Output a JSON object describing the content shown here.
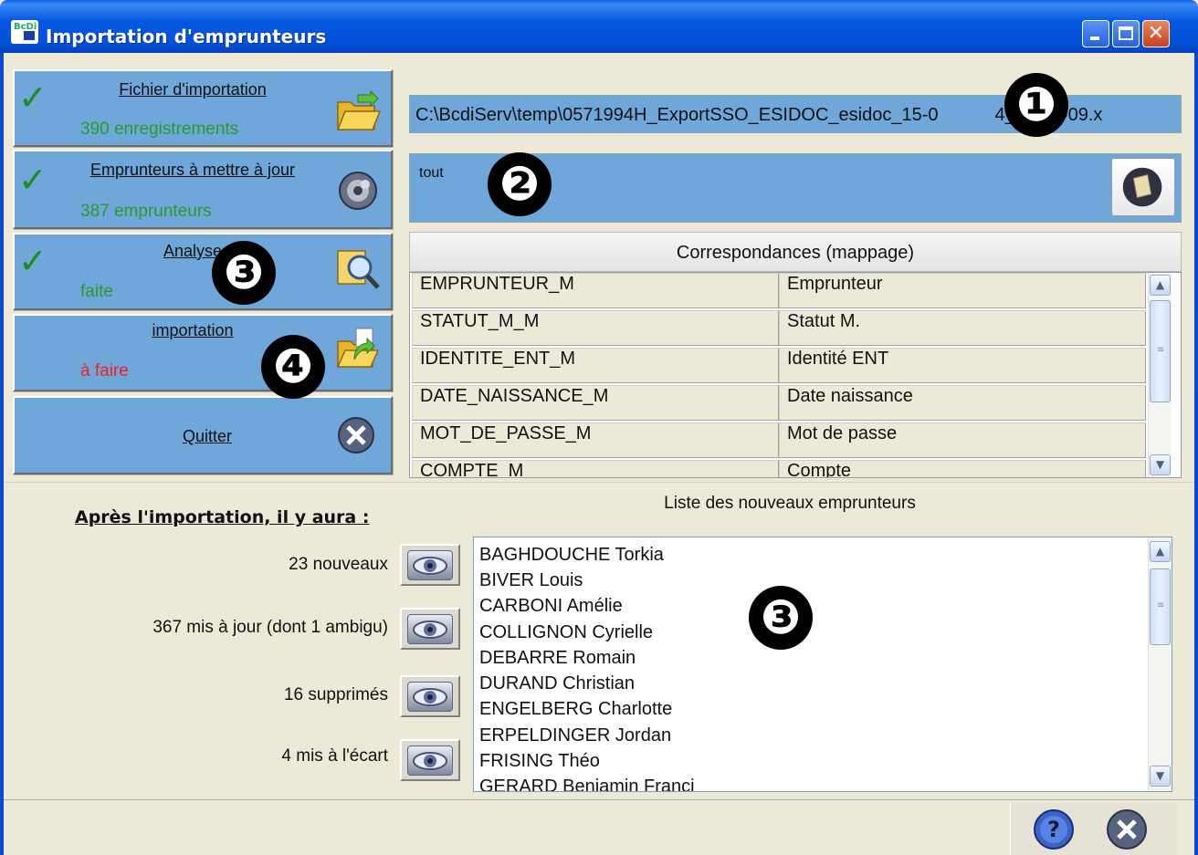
{
  "window": {
    "title": "Importation d'emprunteurs",
    "controls": {
      "minimize": "minimize",
      "maximize": "maximize",
      "close": "close"
    }
  },
  "steps": [
    {
      "title": "Fichier d'importation",
      "status": "390 enregistrements",
      "status_color": "#2a9a2a",
      "done": true,
      "icon": "folder-open-icon"
    },
    {
      "title": "Emprunteurs à mettre à jour",
      "status": "387 emprunteurs",
      "status_color": "#2a9a2a",
      "done": true,
      "icon": "gear-icon"
    },
    {
      "title": "Analyse",
      "status": "faite",
      "status_color": "#2a9a2a",
      "done": true,
      "icon": "magnifier-icon"
    },
    {
      "title": "importation",
      "status": "à faire",
      "status_color": "#ee2222",
      "done": false,
      "icon": "import-folder-icon"
    },
    {
      "title": "Quitter",
      "icon": "close-circle-icon"
    }
  ],
  "file_path": "C:\\BcdiServ\\temp\\0571994H_ExportSSO_ESIDOC_esidoc_15-0",
  "file_path_tail": "4_18-31-09.x",
  "filter": {
    "value": "tout",
    "button_icon": "filter-button-icon"
  },
  "mapping": {
    "header": "Correspondances  (mappage)",
    "rows": [
      {
        "field": "EMPRUNTEUR_M",
        "label": "Emprunteur"
      },
      {
        "field": "STATUT_M_M",
        "label": "Statut M."
      },
      {
        "field": "IDENTITE_ENT_M",
        "label": "Identité ENT"
      },
      {
        "field": "DATE_NAISSANCE_M",
        "label": "Date naissance"
      },
      {
        "field": "MOT_DE_PASSE_M",
        "label": "Mot de passe"
      },
      {
        "field": "COMPTE_M",
        "label": "Compte"
      }
    ]
  },
  "summary": {
    "title": "Après l'importation, il y aura :",
    "stats": [
      {
        "label": "23 nouveaux"
      },
      {
        "label": "367 mis à jour (dont 1 ambigu)"
      },
      {
        "label": "16 supprimés"
      },
      {
        "label": "4 mis à l'écart"
      }
    ]
  },
  "new_borrowers": {
    "title": "Liste des nouveaux emprunteurs",
    "items": [
      "BAGHDOUCHE Torkia",
      "BIVER Louis",
      "CARBONI Amélie",
      "COLLIGNON Cyrielle",
      "DEBARRE Romain",
      "DURAND Christian",
      "ENGELBERG Charlotte",
      "ERPELDINGER Jordan",
      "FRISING Théo",
      "GERARD Benjamin Franci"
    ]
  },
  "annotations": [
    "❶",
    "❷",
    "❸",
    "❹",
    "❸"
  ],
  "footer": {
    "help_icon": "help-icon",
    "close_icon": "close-icon"
  },
  "colors": {
    "title_bar": "#0657e1",
    "panel_blue": "#6fa7db",
    "ok_green": "#1e8c1e",
    "todo_red": "#ee2222"
  }
}
